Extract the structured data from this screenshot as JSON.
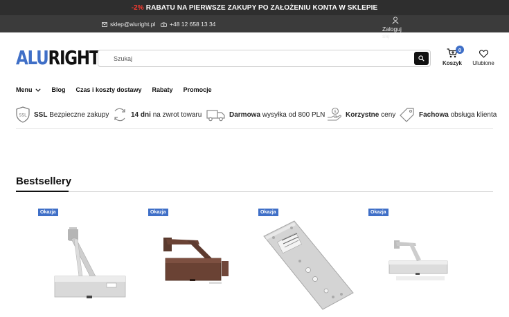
{
  "promo": {
    "accent": "-2%",
    "text": "RABATU NA PIERWSZE ZAKUPY PO ZAŁOŻENIU KONTA W SKLEPIE"
  },
  "topbar": {
    "email": "sklep@aluright.pl",
    "phone": "+48 12 658 13 34",
    "login": "Zaloguj się"
  },
  "logo": {
    "part1": "ALU",
    "part2": "RIGHT"
  },
  "search": {
    "placeholder": "Szukaj"
  },
  "cart": {
    "label": "Koszyk",
    "count": "0"
  },
  "favorites": {
    "label": "Ulubione"
  },
  "nav": {
    "menu": "Menu",
    "items": [
      "Blog",
      "Czas i koszty dostawy",
      "Rabaty",
      "Promocje"
    ]
  },
  "benefits": [
    {
      "strong": "SSL",
      "text": "Bezpieczne zakupy",
      "icon": "ssl-shield-icon"
    },
    {
      "strong": "14 dni",
      "text": "na zwrot towaru",
      "icon": "return-arrows-icon"
    },
    {
      "strong": "Darmowa",
      "text": "wysyłka od 800 PLN",
      "icon": "delivery-truck-icon"
    },
    {
      "strong": "Korzystne",
      "text": "ceny",
      "icon": "money-hand-icon"
    },
    {
      "strong": "Fachowa",
      "text": "obsługa klienta",
      "icon": "price-tag-icon"
    }
  ],
  "section": {
    "title": "Bestsellery"
  },
  "products": [
    {
      "badge": "Okazja",
      "image": "silver-door-closer"
    },
    {
      "badge": "Okazja",
      "image": "brown-door-closer"
    },
    {
      "badge": "Okazja",
      "image": "mounting-plate"
    },
    {
      "badge": "Okazja",
      "image": "small-silver-door-closer"
    }
  ],
  "colors": {
    "accent": "#3f6fc7",
    "promo_accent": "#ff3b30",
    "promo_bg": "#2e2e2e",
    "topbar_bg": "#3b3b3b"
  }
}
